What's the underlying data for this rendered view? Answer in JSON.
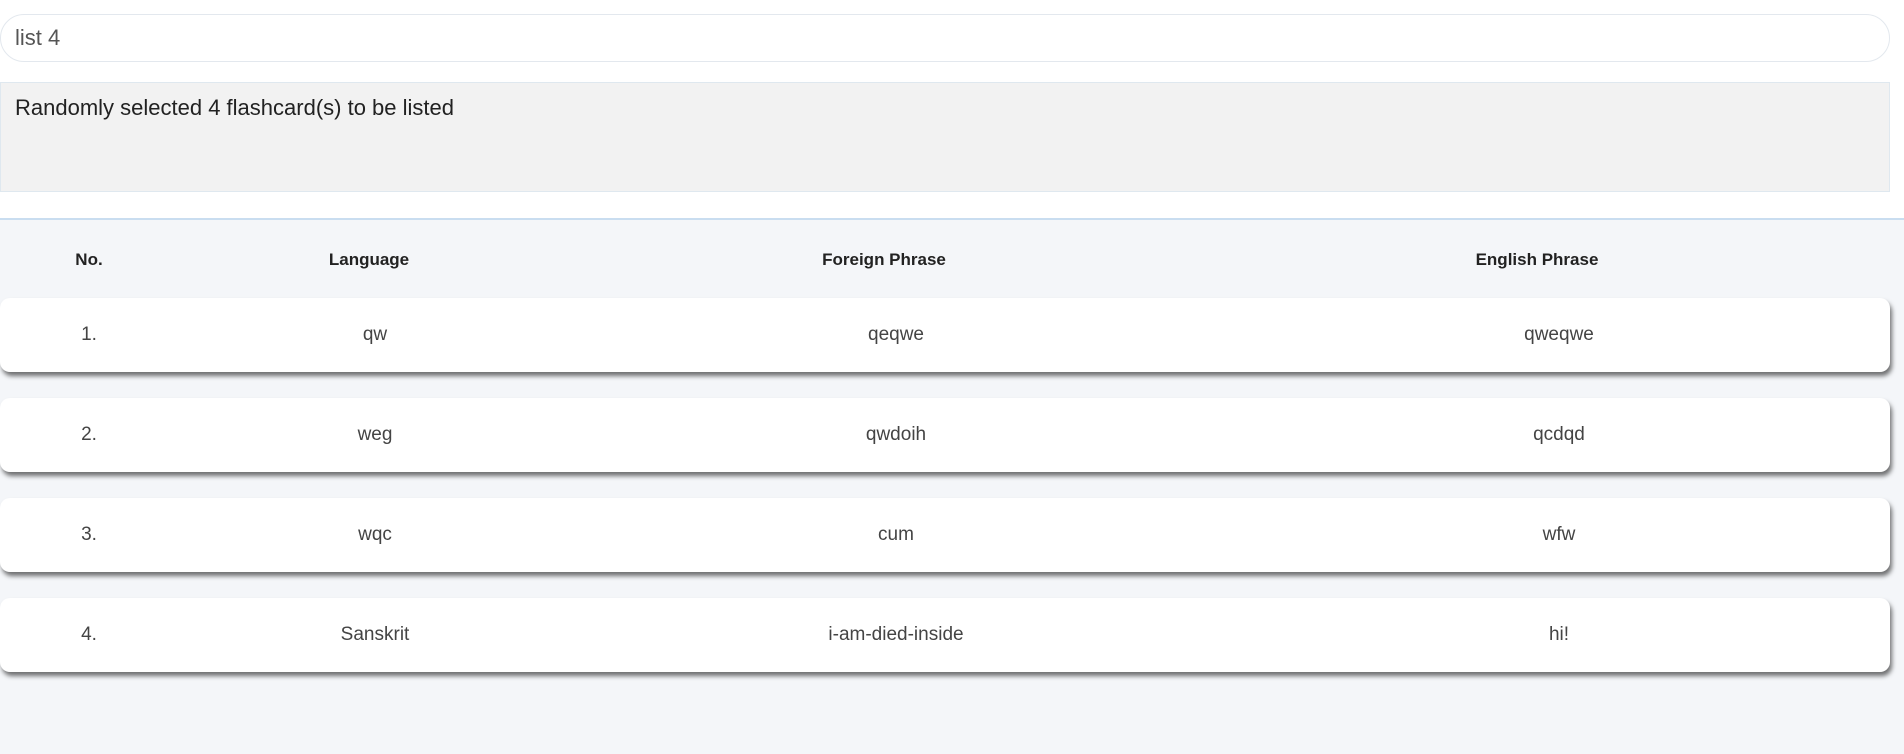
{
  "command": {
    "value": "list 4"
  },
  "output": {
    "message": "Randomly selected 4 flashcard(s) to be listed"
  },
  "table": {
    "headers": {
      "no": "No.",
      "language": "Language",
      "foreign": "Foreign Phrase",
      "english": "English Phrase"
    },
    "rows": [
      {
        "no": "1.",
        "language": "qw",
        "foreign": "qeqwe",
        "english": "qweqwe"
      },
      {
        "no": "2.",
        "language": "weg",
        "foreign": "qwdoih",
        "english": "qcdqd"
      },
      {
        "no": "3.",
        "language": "wqc",
        "foreign": "cum",
        "english": "wfw"
      },
      {
        "no": "4.",
        "language": "Sanskrit",
        "foreign": "i-am-died-inside",
        "english": "hi!"
      }
    ]
  }
}
